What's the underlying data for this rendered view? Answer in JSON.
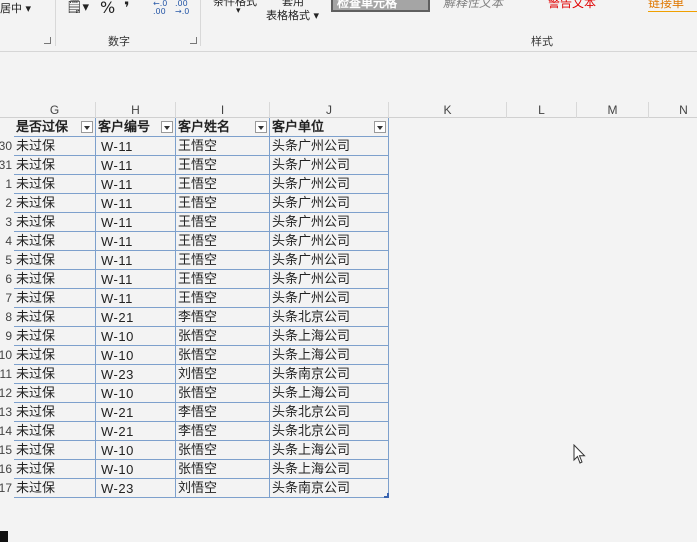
{
  "ribbon": {
    "merge_center": "居中 ▾",
    "number_group": "数字",
    "style_group": "样式",
    "cond_format": "条件格式",
    "table_format_top": "套用",
    "table_format": "表格格式 ▾",
    "style_check": "检查单元格",
    "style_explain": "解释性文本",
    "style_warn": "警告文本",
    "style_link": "链接单",
    "percent": "%",
    "comma": "❜",
    "dec_inc": "←.0 .00",
    "dec_dec": ".00 →.0"
  },
  "columns": [
    "G",
    "H",
    "I",
    "J",
    "K",
    "L",
    "M",
    "N"
  ],
  "headers": {
    "passed": "是否过保",
    "code": "客户编号",
    "name": "客户姓名",
    "company": "客户单位"
  },
  "rows": [
    {
      "num": "30",
      "passed": "未过保",
      "code": "W-11",
      "name": "王悟空",
      "company": "头条广州公司"
    },
    {
      "num": "31",
      "passed": "未过保",
      "code": "W-11",
      "name": "王悟空",
      "company": "头条广州公司"
    },
    {
      "num": "1",
      "passed": "未过保",
      "code": "W-11",
      "name": "王悟空",
      "company": "头条广州公司"
    },
    {
      "num": "2",
      "passed": "未过保",
      "code": "W-11",
      "name": "王悟空",
      "company": "头条广州公司"
    },
    {
      "num": "3",
      "passed": "未过保",
      "code": "W-11",
      "name": "王悟空",
      "company": "头条广州公司"
    },
    {
      "num": "4",
      "passed": "未过保",
      "code": "W-11",
      "name": "王悟空",
      "company": "头条广州公司"
    },
    {
      "num": "5",
      "passed": "未过保",
      "code": "W-11",
      "name": "王悟空",
      "company": "头条广州公司"
    },
    {
      "num": "6",
      "passed": "未过保",
      "code": "W-11",
      "name": "王悟空",
      "company": "头条广州公司"
    },
    {
      "num": "7",
      "passed": "未过保",
      "code": "W-11",
      "name": "王悟空",
      "company": "头条广州公司"
    },
    {
      "num": "8",
      "passed": "未过保",
      "code": "W-21",
      "name": "李悟空",
      "company": "头条北京公司"
    },
    {
      "num": "9",
      "passed": "未过保",
      "code": "W-10",
      "name": "张悟空",
      "company": "头条上海公司"
    },
    {
      "num": "10",
      "passed": "未过保",
      "code": "W-10",
      "name": "张悟空",
      "company": "头条上海公司"
    },
    {
      "num": "11",
      "passed": "未过保",
      "code": "W-23",
      "name": "刘悟空",
      "company": "头条南京公司"
    },
    {
      "num": "12",
      "passed": "未过保",
      "code": "W-10",
      "name": "张悟空",
      "company": "头条上海公司"
    },
    {
      "num": "13",
      "passed": "未过保",
      "code": "W-21",
      "name": "李悟空",
      "company": "头条北京公司"
    },
    {
      "num": "14",
      "passed": "未过保",
      "code": "W-21",
      "name": "李悟空",
      "company": "头条北京公司"
    },
    {
      "num": "15",
      "passed": "未过保",
      "code": "W-10",
      "name": "张悟空",
      "company": "头条上海公司"
    },
    {
      "num": "16",
      "passed": "未过保",
      "code": "W-10",
      "name": "张悟空",
      "company": "头条上海公司"
    },
    {
      "num": "17",
      "passed": "未过保",
      "code": "W-23",
      "name": "刘悟空",
      "company": "头条南京公司"
    }
  ]
}
